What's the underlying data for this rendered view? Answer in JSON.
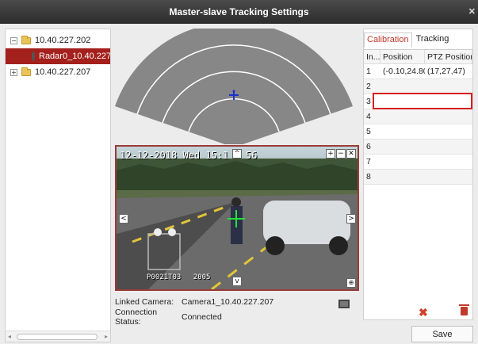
{
  "window": {
    "title": "Master-slave Tracking Settings",
    "close_icon": "close-icon"
  },
  "tree": {
    "items": [
      {
        "label": "10.40.227.202",
        "expander": "−",
        "icon": "folder-icon"
      },
      {
        "label": "Radar0_10.40.227.2",
        "icon": "radar-icon",
        "selected": true
      },
      {
        "label": "10.40.227.207",
        "expander": "+",
        "icon": "folder-icon"
      }
    ]
  },
  "video": {
    "osd_datetime": "12-12-2018 Wed 15:1",
    "osd_seconds": "56",
    "osd_bottom": "P0021T03",
    "osd_bottom2": "2005",
    "controls": {
      "zoom_in": "+",
      "zoom_out": "−",
      "close": "✕",
      "up": "^",
      "down": "v",
      "left": "<",
      "right": ">"
    }
  },
  "info": {
    "linked_camera_label": "Linked Camera:",
    "linked_camera_value": "Camera1_10.40.227.207",
    "connection_label": "Connection Status:",
    "connection_value": "Connected"
  },
  "tabs": [
    {
      "label": "Calibration",
      "active": true
    },
    {
      "label": "Tracking",
      "active": false
    }
  ],
  "table": {
    "headers": [
      "In...",
      "Position",
      "PTZ Position"
    ],
    "rows": [
      [
        "1",
        "(-0.10,24.80)",
        "(17,27,47)"
      ],
      [
        "2",
        "",
        ""
      ],
      [
        "3",
        "",
        ""
      ],
      [
        "4",
        "",
        ""
      ],
      [
        "5",
        "",
        ""
      ],
      [
        "6",
        "",
        ""
      ],
      [
        "7",
        "",
        ""
      ],
      [
        "8",
        "",
        ""
      ]
    ]
  },
  "colors": {
    "accent": "#c0392b",
    "selected_row": "#a3201c",
    "radar_fill": "#808080"
  },
  "buttons": {
    "save": "Save"
  }
}
